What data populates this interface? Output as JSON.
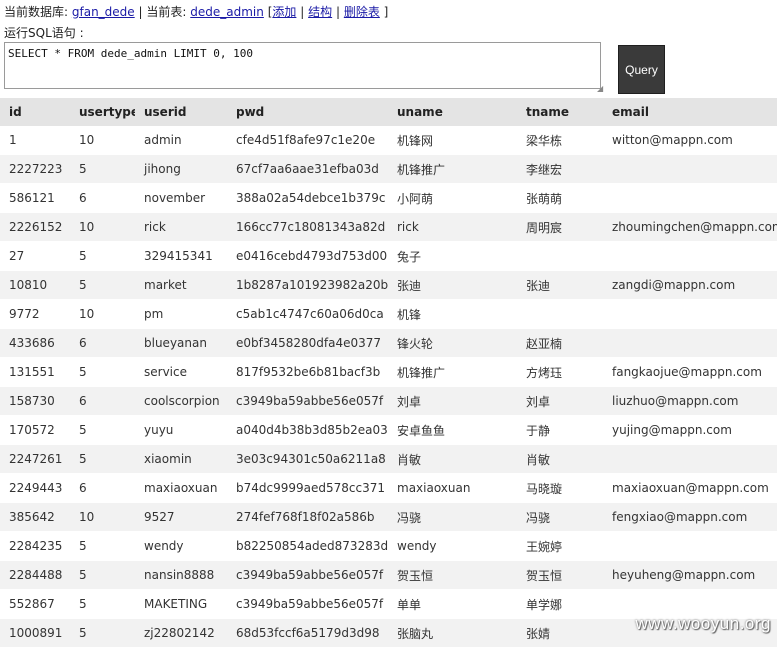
{
  "header": {
    "db_label": "当前数据库:",
    "db_name": "gfan_dede",
    "table_label": "当前表:",
    "table_name": "dede_admin",
    "bracket_open": "[",
    "add_link": "添加",
    "struct_link": "结构",
    "drop_link": "删除表",
    "bracket_close": "]",
    "sep": "|"
  },
  "sql": {
    "label": "运行SQL语句 :",
    "value": "SELECT * FROM dede_admin LIMIT 0, 100"
  },
  "query_button": {
    "label": "Query"
  },
  "table": {
    "columns": [
      "id",
      "usertype",
      "userid",
      "pwd",
      "uname",
      "tname",
      "email"
    ],
    "rows": [
      [
        "1",
        "10",
        "admin",
        "cfe4d51f8afe97c1e20e",
        "机锋网",
        "梁华栋",
        "witton@mappn.com"
      ],
      [
        "2227223",
        "5",
        "jihong",
        "67cf7aa6aae31efba03d",
        "机锋推广",
        "李继宏",
        ""
      ],
      [
        "586121",
        "6",
        "november",
        "388a02a54debce1b379c",
        "小阿萌",
        "张萌萌",
        ""
      ],
      [
        "2226152",
        "10",
        "rick",
        "166cc77c18081343a82d",
        "rick",
        "周明宸",
        "zhoumingchen@mappn.com"
      ],
      [
        "27",
        "5",
        "329415341",
        "e0416cebd4793d753d00",
        "兔子",
        "",
        ""
      ],
      [
        "10810",
        "5",
        "market",
        "1b8287a101923982a20b",
        "张迪",
        "张迪",
        "zangdi@mappn.com"
      ],
      [
        "9772",
        "10",
        "pm",
        "c5ab1c4747c60a06d0ca",
        "机锋",
        "",
        ""
      ],
      [
        "433686",
        "6",
        "blueyanan",
        "e0bf3458280dfa4e0377",
        "锋火轮",
        "赵亚楠",
        ""
      ],
      [
        "131551",
        "5",
        "service",
        "817f9532be6b81bacf3b",
        "机锋推广",
        "方烤珏",
        "fangkaojue@mappn.com"
      ],
      [
        "158730",
        "6",
        "coolscorpion",
        "c3949ba59abbe56e057f",
        "刘卓",
        "刘卓",
        "liuzhuo@mappn.com"
      ],
      [
        "170572",
        "5",
        "yuyu",
        "a040d4b38b3d85b2ea03",
        "安卓鱼鱼",
        "于静",
        "yujing@mappn.com"
      ],
      [
        "2247261",
        "5",
        "xiaomin",
        "3e03c94301c50a6211a8",
        "肖敏",
        "肖敏",
        ""
      ],
      [
        "2249443",
        "6",
        "maxiaoxuan",
        "b74dc9999aed578cc371",
        "maxiaoxuan",
        "马晓璇",
        "maxiaoxuan@mappn.com"
      ],
      [
        "385642",
        "10",
        "9527",
        "274fef768f18f02a586b",
        "冯骁",
        "冯骁",
        "fengxiao@mappn.com"
      ],
      [
        "2284235",
        "5",
        "wendy",
        "b82250854aded873283d",
        "wendy",
        "王婉婷",
        ""
      ],
      [
        "2284488",
        "5",
        "nansin8888",
        "c3949ba59abbe56e057f",
        "贺玉恒",
        "贺玉恒",
        "heyuheng@mappn.com"
      ],
      [
        "552867",
        "5",
        "MAKETING",
        "c3949ba59abbe56e057f",
        "单单",
        "单学娜",
        ""
      ],
      [
        "1000891",
        "5",
        "zj22802142",
        "68d53fccf6a5179d3d98",
        "张脑丸",
        "张婧",
        ""
      ]
    ]
  },
  "watermark": "www.wooyun.org"
}
